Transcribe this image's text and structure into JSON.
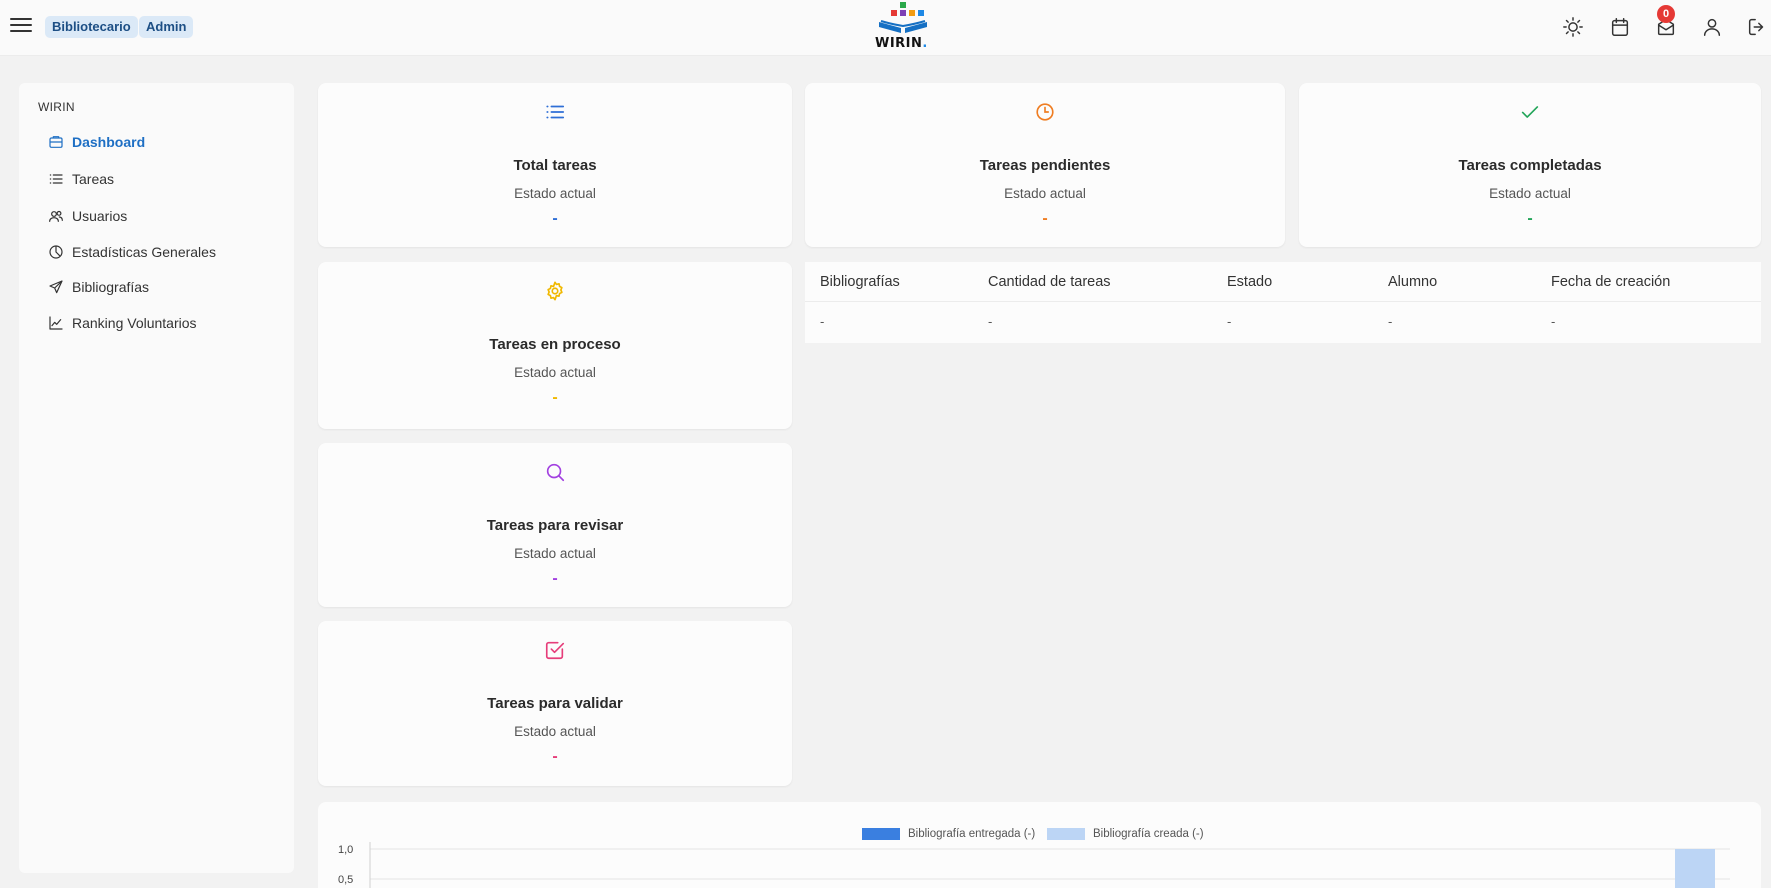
{
  "header": {
    "badges": [
      "Bibliotecario",
      "Admin"
    ],
    "logo_text": "WIRIN",
    "logo_dot": ".",
    "notifications_count": "0",
    "icons": [
      "sun-icon",
      "calendar-icon",
      "mail-icon",
      "user-icon",
      "logout-icon"
    ]
  },
  "sidebar": {
    "title": "WIRIN",
    "items": [
      {
        "label": "Dashboard",
        "icon": "dashboard-icon",
        "active": true
      },
      {
        "label": "Tareas",
        "icon": "list-icon"
      },
      {
        "label": "Usuarios",
        "icon": "users-icon"
      },
      {
        "label": "Estadísticas Generales",
        "icon": "pie-chart-icon"
      },
      {
        "label": "Bibliografías",
        "icon": "send-icon"
      },
      {
        "label": "Ranking Voluntarios",
        "icon": "trend-chart-icon"
      }
    ]
  },
  "cards": [
    {
      "title": "Total tareas",
      "subtitle": "Estado actual",
      "value": "-",
      "icon": "list-icon",
      "color": "#2f6fd6"
    },
    {
      "title": "Tareas pendientes",
      "subtitle": "Estado actual",
      "value": "-",
      "icon": "clock-icon",
      "color": "#ef7d22"
    },
    {
      "title": "Tareas completadas",
      "subtitle": "Estado actual",
      "value": "-",
      "icon": "check-icon",
      "color": "#22a559"
    },
    {
      "title": "Tareas en proceso",
      "subtitle": "Estado actual",
      "value": "-",
      "icon": "gear-icon",
      "color": "#f0b800"
    },
    {
      "title": "Tareas para revisar",
      "subtitle": "Estado actual",
      "value": "-",
      "icon": "search-icon",
      "color": "#a240e0"
    },
    {
      "title": "Tareas para validar",
      "subtitle": "Estado actual",
      "value": "-",
      "icon": "checkbox-icon",
      "color": "#e63d7a"
    }
  ],
  "table": {
    "headers": [
      "Bibliografías",
      "Cantidad de tareas",
      "Estado",
      "Alumno",
      "Fecha de creación"
    ],
    "rows": [
      [
        "-",
        "-",
        "-",
        "-",
        "-"
      ]
    ]
  },
  "chart_data": {
    "type": "bar",
    "legend": [
      "Bibliografía entregada (-)",
      "Bibliografía creada (-)"
    ],
    "legend_position": "top-center",
    "series": [
      {
        "name": "Bibliografía entregada (-)",
        "color": "#3a7fe0",
        "values": []
      },
      {
        "name": "Bibliografía creada (-)",
        "color": "#bcd5f5",
        "values": [
          1.0
        ]
      }
    ],
    "y_ticks": [
      "1,0",
      "0,5"
    ],
    "ylim": [
      0,
      1.0
    ],
    "grid": true
  }
}
